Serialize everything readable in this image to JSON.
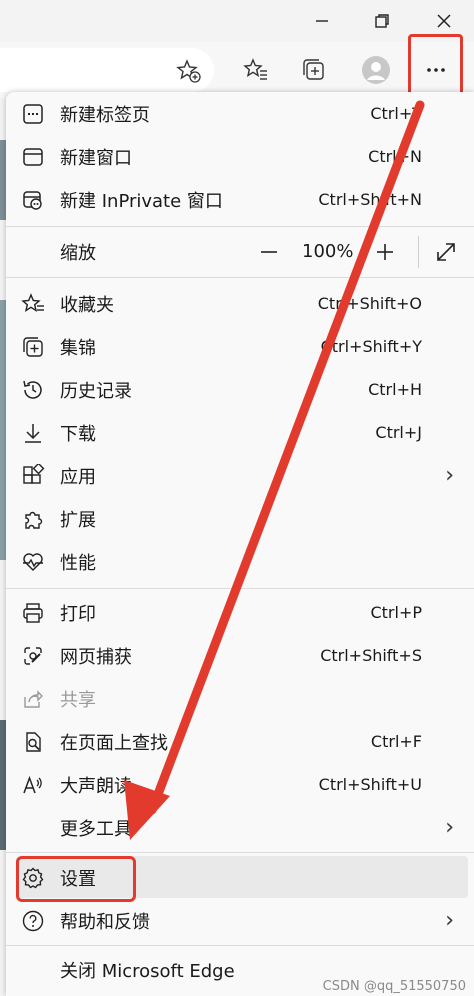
{
  "menu": {
    "items": [
      {
        "label": "新建标签页",
        "shortcut": "Ctrl+T"
      },
      {
        "label": "新建窗口",
        "shortcut": "Ctrl+N"
      },
      {
        "label": "新建 InPrivate 窗口",
        "shortcut": "Ctrl+Shift+N"
      }
    ],
    "zoom": {
      "label": "缩放",
      "value": "100%",
      "minus": "—",
      "plus": "+"
    },
    "items2": [
      {
        "label": "收藏夹",
        "shortcut": "Ctrl+Shift+O"
      },
      {
        "label": "集锦",
        "shortcut": "Ctrl+Shift+Y"
      },
      {
        "label": "历史记录",
        "shortcut": "Ctrl+H"
      },
      {
        "label": "下载",
        "shortcut": "Ctrl+J"
      },
      {
        "label": "应用",
        "shortcut": ""
      },
      {
        "label": "扩展",
        "shortcut": ""
      },
      {
        "label": "性能",
        "shortcut": ""
      }
    ],
    "items3": [
      {
        "label": "打印",
        "shortcut": "Ctrl+P"
      },
      {
        "label": "网页捕获",
        "shortcut": "Ctrl+Shift+S"
      },
      {
        "label": "共享",
        "shortcut": ""
      },
      {
        "label": "在页面上查找",
        "shortcut": "Ctrl+F"
      },
      {
        "label": "大声朗读",
        "shortcut": "Ctrl+Shift+U"
      },
      {
        "label": "更多工具",
        "shortcut": ""
      }
    ],
    "items4": [
      {
        "label": "设置",
        "shortcut": ""
      },
      {
        "label": "帮助和反馈",
        "shortcut": ""
      },
      {
        "label": "关闭 Microsoft Edge",
        "shortcut": ""
      }
    ]
  },
  "watermark": "CSDN @qq_51550750",
  "colors": {
    "highlight": "#e23b2e",
    "menu_bg": "#f9f9f9"
  }
}
